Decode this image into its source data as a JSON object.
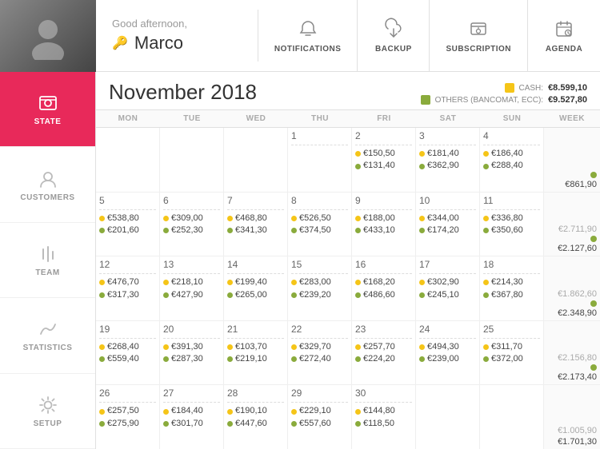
{
  "sidebar": {
    "items": [
      {
        "id": "state",
        "label": "STATE",
        "active": true
      },
      {
        "id": "customers",
        "label": "CUSTOMERS",
        "active": false
      },
      {
        "id": "team",
        "label": "TEAM",
        "active": false
      },
      {
        "id": "statistics",
        "label": "STATISTICS",
        "active": false
      },
      {
        "id": "setup",
        "label": "SETUP",
        "active": false
      }
    ]
  },
  "topbar": {
    "greeting": "Good afternoon,",
    "username": "Marco",
    "actions": [
      {
        "id": "notifications",
        "label": "NOTIFICATIONS"
      },
      {
        "id": "backup",
        "label": "BACKUP"
      },
      {
        "id": "subscription",
        "label": "SUBSCRIPTION"
      },
      {
        "id": "agenda",
        "label": "AGENDA"
      }
    ]
  },
  "calendar": {
    "title": "November 2018",
    "legend": {
      "cash_label": "CASH:",
      "cash_value": "€8.599,10",
      "others_label": "OTHERS (BANCOMAT, ECC):",
      "others_value": "€9.527,80"
    },
    "day_headers": [
      "MON",
      "TUE",
      "WED",
      "THU",
      "FRI",
      "SAT",
      "SUN",
      "WEEK"
    ],
    "weeks": [
      {
        "cells": [
          {
            "date": "",
            "y": "",
            "o": ""
          },
          {
            "date": "",
            "y": "",
            "o": ""
          },
          {
            "date": "",
            "y": "",
            "o": ""
          },
          {
            "date": "1",
            "y": "",
            "o": ""
          },
          {
            "date": "2",
            "y": "€150,50",
            "o": "€131,40"
          },
          {
            "date": "3",
            "y": "€181,40",
            "o": "€362,90"
          },
          {
            "date": "4",
            "y": "€186,40",
            "o": "€288,40"
          }
        ],
        "week_dot": true,
        "week_amount": "€861,90"
      },
      {
        "cells": [
          {
            "date": "5",
            "y": "€538,80",
            "o": "€201,60"
          },
          {
            "date": "6",
            "y": "€309,00",
            "o": "€252,30"
          },
          {
            "date": "7",
            "y": "€468,80",
            "o": "€341,30"
          },
          {
            "date": "8",
            "y": "€526,50",
            "o": "€374,50"
          },
          {
            "date": "9",
            "y": "€188,00",
            "o": "€433,10"
          },
          {
            "date": "10",
            "y": "€344,00",
            "o": "€174,20"
          },
          {
            "date": "11",
            "y": "€336,80",
            "o": "€350,60"
          }
        ],
        "week_dot": true,
        "week_amount": "€2.127,60",
        "week_top": "€2.711,90"
      },
      {
        "cells": [
          {
            "date": "12",
            "y": "€476,70",
            "o": "€317,30"
          },
          {
            "date": "13",
            "y": "€218,10",
            "o": "€427,90"
          },
          {
            "date": "14",
            "y": "€199,40",
            "o": "€265,00"
          },
          {
            "date": "15",
            "y": "€283,00",
            "o": "€239,20"
          },
          {
            "date": "16",
            "y": "€168,20",
            "o": "€486,60"
          },
          {
            "date": "17",
            "y": "€302,90",
            "o": "€245,10"
          },
          {
            "date": "18",
            "y": "€214,30",
            "o": "€367,80"
          }
        ],
        "week_dot": true,
        "week_amount": "€2.348,90",
        "week_top": "€1.862,60"
      },
      {
        "cells": [
          {
            "date": "19",
            "y": "€268,40",
            "o": "€559,40"
          },
          {
            "date": "20",
            "y": "€391,30",
            "o": "€287,30"
          },
          {
            "date": "21",
            "y": "€103,70",
            "o": "€219,10"
          },
          {
            "date": "22",
            "y": "€329,70",
            "o": "€272,40"
          },
          {
            "date": "23",
            "y": "€257,70",
            "o": "€224,20"
          },
          {
            "date": "24",
            "y": "€494,30",
            "o": "€239,00"
          },
          {
            "date": "25",
            "y": "€311,70",
            "o": "€372,00"
          }
        ],
        "week_dot": true,
        "week_amount": "€2.173,40",
        "week_top": "€2.156,80"
      },
      {
        "cells": [
          {
            "date": "26",
            "y": "€257,50",
            "o": "€275,90"
          },
          {
            "date": "27",
            "y": "€184,40",
            "o": "€301,70"
          },
          {
            "date": "28",
            "y": "€190,10",
            "o": "€447,60"
          },
          {
            "date": "29",
            "y": "€229,10",
            "o": "€557,60"
          },
          {
            "date": "30",
            "y": "€144,80",
            "o": "€118,50"
          },
          {
            "date": "",
            "y": "",
            "o": ""
          },
          {
            "date": "",
            "y": "",
            "o": ""
          }
        ],
        "week_dot": false,
        "week_amount": "€1.701,30",
        "week_top": "€1.005,90"
      }
    ]
  }
}
